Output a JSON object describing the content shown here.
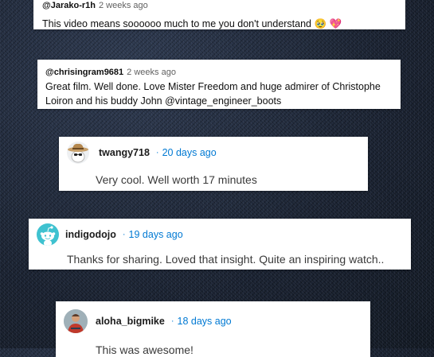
{
  "comments": [
    {
      "user": "@Jarako-r1h",
      "time": "2 weeks ago",
      "text": "This video means soooooo much to me you don't understand 🥹 💖"
    },
    {
      "user": "@chrisingram9681",
      "time": "2 weeks ago",
      "text": "Great film. Well done. Love Mister Freedom and huge admirer of Christophe Loiron and his buddy John @vintage_engineer_boots"
    },
    {
      "user": "twangy718",
      "separator": "·",
      "time": "20 days ago",
      "text": "Very cool. Well worth 17 minutes",
      "avatar": "cowboy-hat-avatar"
    },
    {
      "user": "indigodojo",
      "separator": "·",
      "time": "19 days ago",
      "text": "Thanks for sharing. Loved that insight. Quite an inspiring watch..",
      "avatar": "snoo-default-avatar"
    },
    {
      "user": "aloha_bigmike",
      "separator": "·",
      "time": "18 days ago",
      "text": "This was awesome!",
      "avatar": "photo-avatar"
    }
  ],
  "colors": {
    "reddit_link": "#0079d3",
    "avatar_teal": "#3fc2d0",
    "background": "#1f2838"
  }
}
